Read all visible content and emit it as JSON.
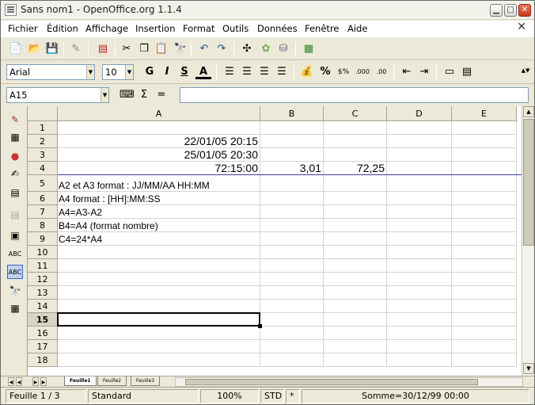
{
  "window": {
    "title": "Sans nom1 - OpenOffice.org 1.1.4"
  },
  "menu": {
    "items": [
      "Fichier",
      "Édition",
      "Affichage",
      "Insertion",
      "Format",
      "Outils",
      "Données",
      "Fenêtre",
      "Aide"
    ]
  },
  "toolbar": {
    "font_name": "Arial",
    "font_size": "10",
    "bold_label": "G",
    "italic_label": "I",
    "underline_label": "S",
    "fontcolor_label": "A",
    "percent_label": "%"
  },
  "formula_bar": {
    "cell_ref": "A15",
    "sigma": "Σ",
    "equals": "=",
    "content": ""
  },
  "grid": {
    "columns": [
      "A",
      "B",
      "C",
      "D",
      "E"
    ],
    "rows": [
      "1",
      "2",
      "3",
      "4",
      "5",
      "6",
      "7",
      "8",
      "9",
      "10",
      "11",
      "12",
      "13",
      "14",
      "15",
      "16",
      "17",
      "18"
    ],
    "cells": {
      "A2": "22/01/05 20:15",
      "A3": "25/01/05 20:30",
      "A4": "72:15:00",
      "B4": "3,01",
      "C4": "72,25",
      "A5": "A2 et A3 format : JJ/MM/AA HH:MM",
      "A6": "A4 format : [HH]:MM:SS",
      "A7": "A4=A3-A2",
      "A8": "B4=A4 (format nombre)",
      "A9": "C4=24*A4"
    },
    "active_row": "15"
  },
  "sheets": [
    "Feuille1",
    "Feuille2",
    "Feuille3"
  ],
  "status": {
    "sheet": "Feuille 1 / 3",
    "style": "Standard",
    "zoom": "100%",
    "mode": "STD",
    "modified": "*",
    "sum": "Somme=30/12/99 00:00"
  },
  "icons": {
    "new": "new-document-icon",
    "open": "open-folder-icon",
    "save": "save-icon"
  }
}
